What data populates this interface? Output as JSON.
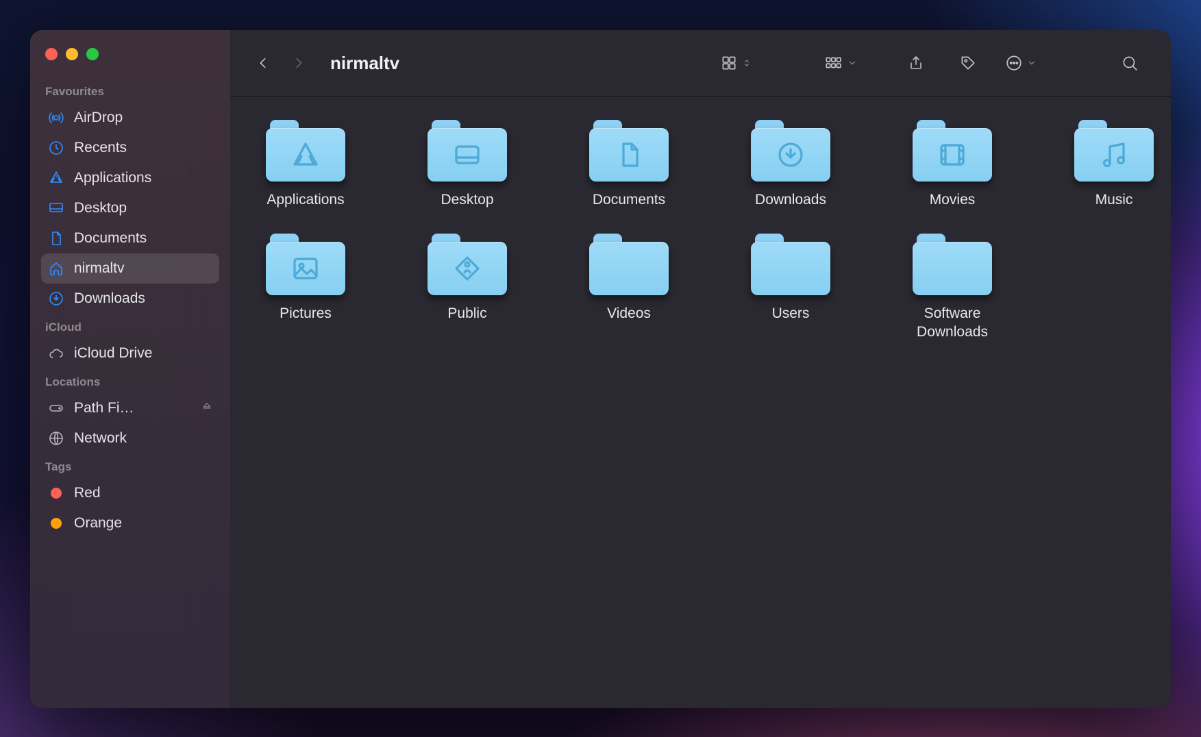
{
  "window_title": "nirmaltv",
  "sidebar": {
    "sections": [
      {
        "title": "Favourites",
        "items": [
          {
            "icon": "airdrop",
            "label": "AirDrop"
          },
          {
            "icon": "clock",
            "label": "Recents"
          },
          {
            "icon": "apps",
            "label": "Applications"
          },
          {
            "icon": "desktop",
            "label": "Desktop"
          },
          {
            "icon": "doc",
            "label": "Documents"
          },
          {
            "icon": "home",
            "label": "nirmaltv",
            "selected": true
          },
          {
            "icon": "download",
            "label": "Downloads"
          }
        ]
      },
      {
        "title": "iCloud",
        "items": [
          {
            "icon": "cloud",
            "label": "iCloud Drive",
            "gray": true
          }
        ]
      },
      {
        "title": "Locations",
        "items": [
          {
            "icon": "disk",
            "label": "Path Fi…",
            "gray": true,
            "eject": true
          },
          {
            "icon": "network",
            "label": "Network",
            "gray": true
          }
        ]
      },
      {
        "title": "Tags",
        "items": [
          {
            "icon": "tagdot",
            "color": "#ff5f57",
            "label": "Red"
          },
          {
            "icon": "tagdot",
            "color": "#ff9f0a",
            "label": "Orange"
          }
        ]
      }
    ]
  },
  "folders": [
    {
      "name": "Applications",
      "glyph": "apps"
    },
    {
      "name": "Desktop",
      "glyph": "desktop"
    },
    {
      "name": "Documents",
      "glyph": "doc"
    },
    {
      "name": "Downloads",
      "glyph": "download"
    },
    {
      "name": "Movies",
      "glyph": "movie"
    },
    {
      "name": "Music",
      "glyph": "music"
    },
    {
      "name": "Pictures",
      "glyph": "picture"
    },
    {
      "name": "Public",
      "glyph": "public"
    },
    {
      "name": "Videos",
      "glyph": ""
    },
    {
      "name": "Users",
      "glyph": ""
    },
    {
      "name": "Software Downloads",
      "glyph": ""
    }
  ]
}
